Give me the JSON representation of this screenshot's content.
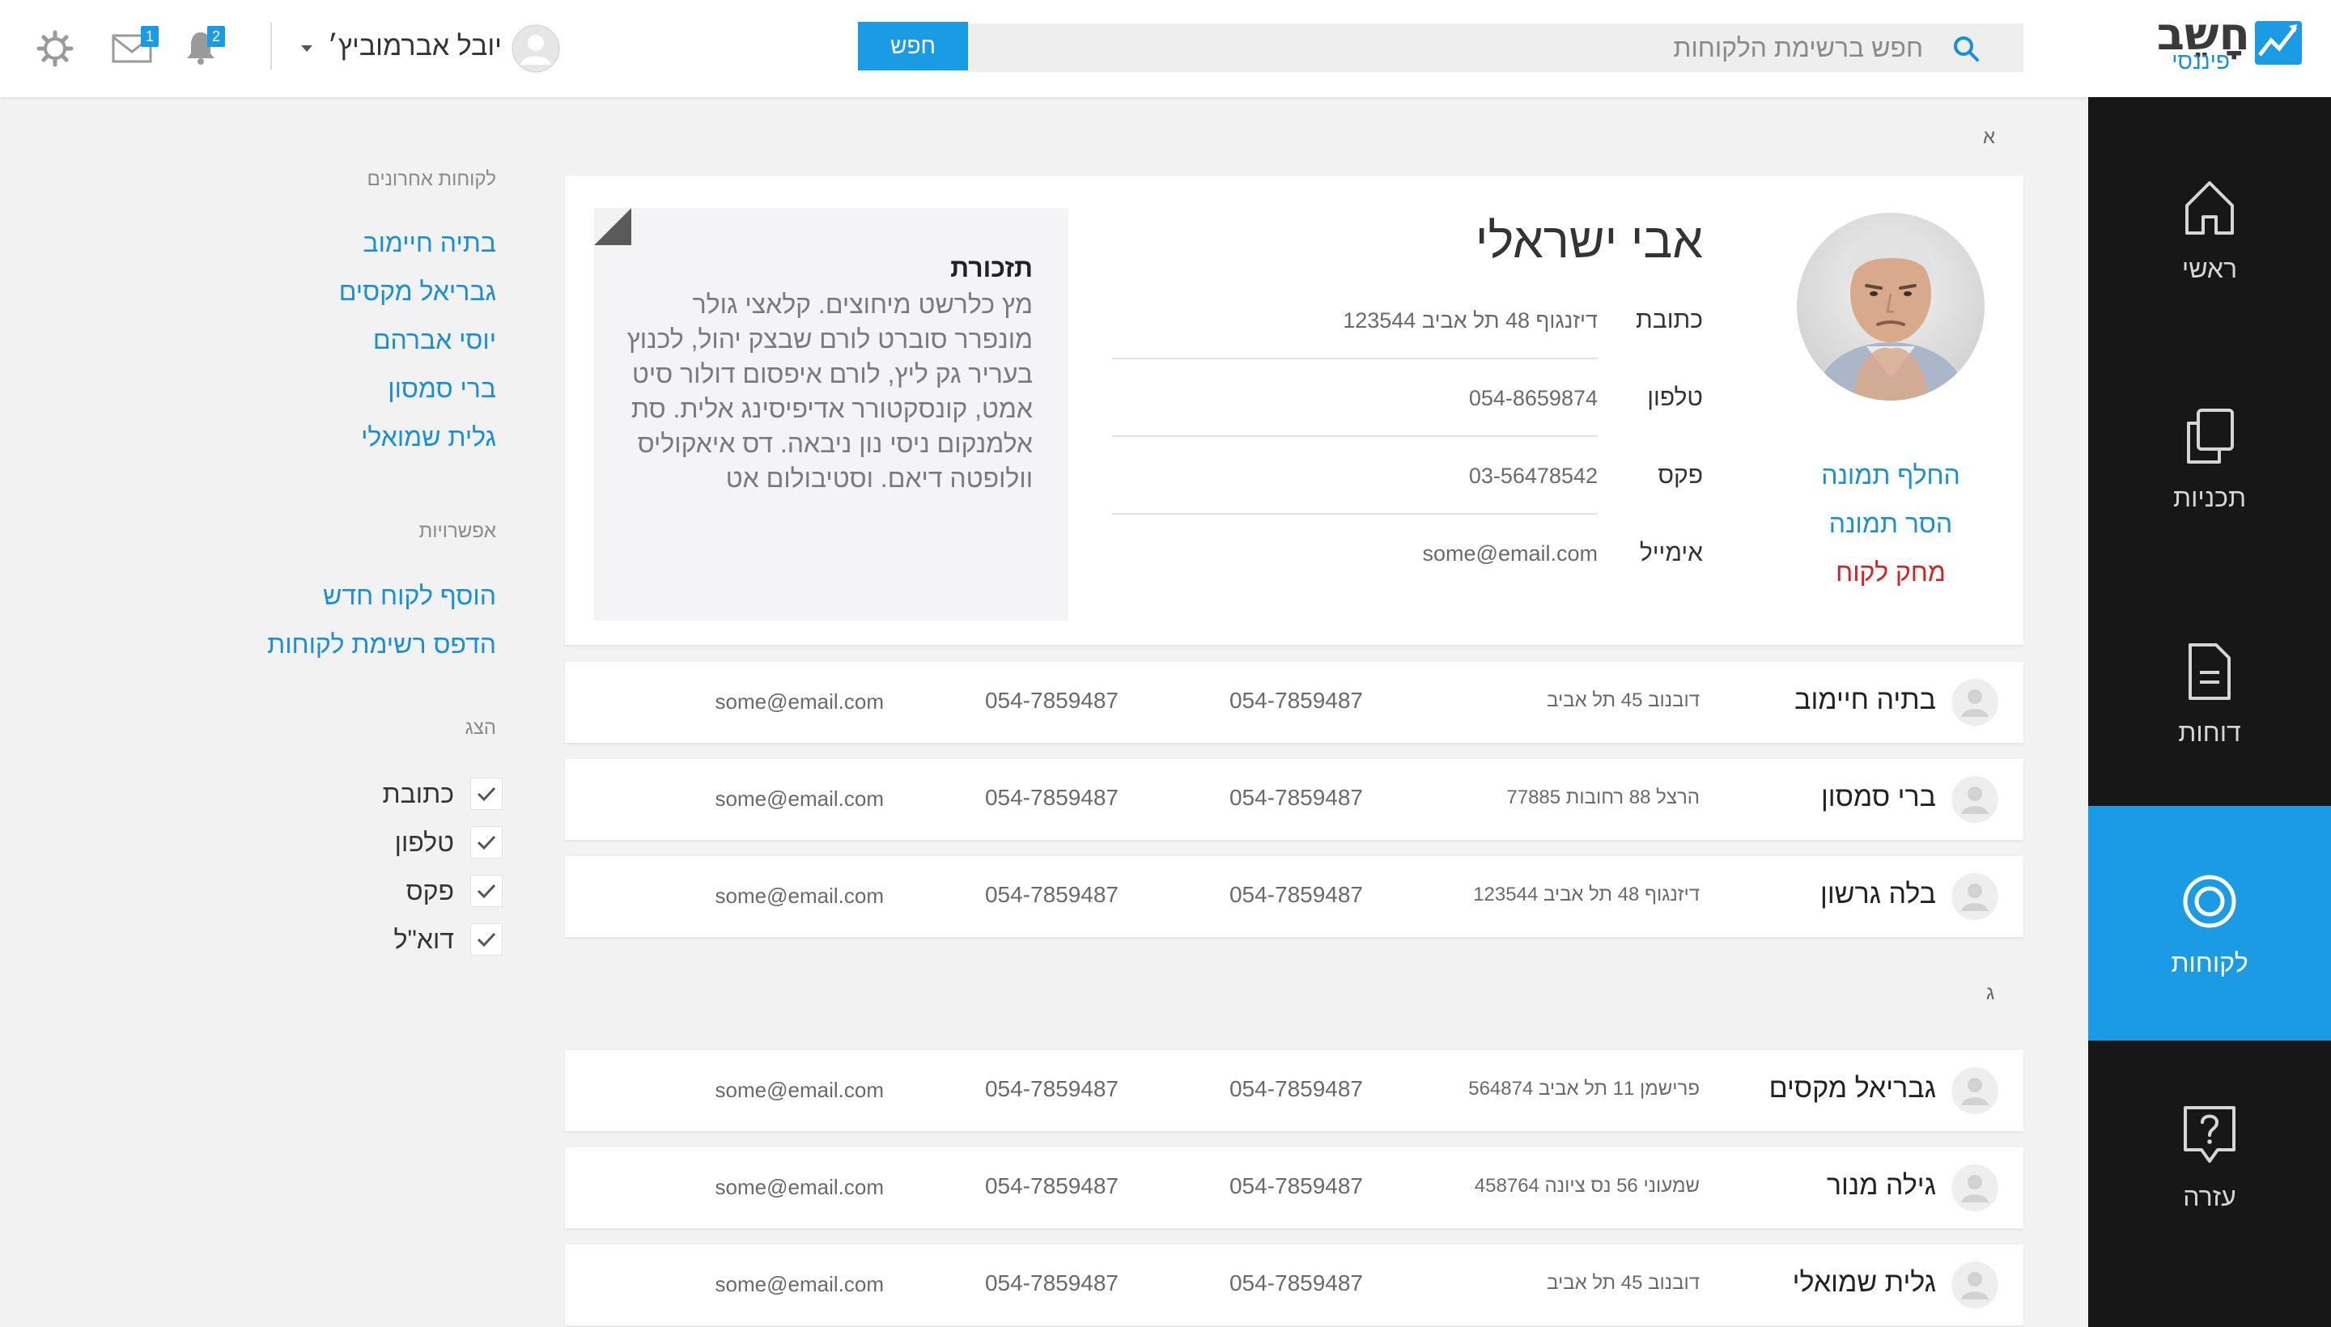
{
  "app": {
    "brand": "חָשֵב",
    "brand_sub": "פיננסי",
    "accent_color": "#1a9be3"
  },
  "header": {
    "search_placeholder": "חפש ברשימת הלקוחות",
    "search_button": "חפש",
    "user_name": "יובל אברמוביץ׳",
    "mail_badge": "1",
    "notifications_badge": "2",
    "icons": [
      "search-icon",
      "user-avatar-icon",
      "caret-down-icon",
      "envelope-icon",
      "bell-icon",
      "gear-icon"
    ]
  },
  "nav": {
    "items": [
      {
        "label": "ראשי",
        "icon": "home-icon",
        "active": false
      },
      {
        "label": "תכניות",
        "icon": "copy-icon",
        "active": false
      },
      {
        "label": "דוחות",
        "icon": "document-icon",
        "active": false
      },
      {
        "label": "לקוחות",
        "icon": "target-icon",
        "active": true
      },
      {
        "label": "עזרה",
        "icon": "help-bubble-icon",
        "active": false
      }
    ]
  },
  "panel": {
    "recent_heading": "לקוחות אחרונים",
    "recent": [
      "בתיה חיימוב",
      "גבריאל מקסים",
      "יוסי אברהם",
      "ברי סמסון",
      "גלית שמואלי"
    ],
    "options_heading": "אפשרויות",
    "options": [
      "הוסף לקוח חדש",
      "הדפס רשימת לקוחות"
    ],
    "show_heading": "הצג",
    "show": [
      {
        "label": "כתובת",
        "checked": true
      },
      {
        "label": "טלפון",
        "checked": true
      },
      {
        "label": "פקס",
        "checked": true
      },
      {
        "label": "דוא\"ל",
        "checked": true
      }
    ]
  },
  "sections": [
    {
      "letter": "א"
    },
    {
      "letter": "ג"
    }
  ],
  "detail": {
    "name": "אבי ישראלי",
    "fields": [
      {
        "label": "כתובת",
        "value": "דיזנגוף 48 תל אביב 123544"
      },
      {
        "label": "טלפון",
        "value": "054-8659874"
      },
      {
        "label": "פקס",
        "value": "03-56478542"
      },
      {
        "label": "אימייל",
        "value": "some@email.com"
      }
    ],
    "photo_actions": {
      "change": "החלף תמונה",
      "remove": "הסר תמונה",
      "delete": "מחק לקוח"
    },
    "note": {
      "title": "תזכורת",
      "body": "מץ כלרשט מיחוצים. קלאצי גולר מונפרר סוברט לורם שבצק יהול, לכנוץ בעריר גק ליץ, לורם איפסום דולור סיט אמט, קונסקטורר אדיפיסינג אלית. סת אלמנקום ניסי נון ניבאה. דס איאקוליס וולופטה דיאם. וסטיבולום אט"
    }
  },
  "section_a_rows": [
    {
      "name": "בתיה חיימוב",
      "address": "דובנוב 45 תל אביב",
      "phone": "054-7859487",
      "fax": "054-7859487",
      "email": "some@email.com"
    },
    {
      "name": "ברי סמסון",
      "address": "הרצל 88 רחובות 77885",
      "phone": "054-7859487",
      "fax": "054-7859487",
      "email": "some@email.com"
    },
    {
      "name": "בלה גרשון",
      "address": "דיזנגוף 48 תל אביב 123544",
      "phone": "054-7859487",
      "fax": "054-7859487",
      "email": "some@email.com"
    }
  ],
  "section_g_rows": [
    {
      "name": "גבריאל מקסים",
      "address": "פרישמן 11 תל אביב 564874",
      "phone": "054-7859487",
      "fax": "054-7859487",
      "email": "some@email.com"
    },
    {
      "name": "גילה מנור",
      "address": "שמעוני 56 נס ציונה 458764",
      "phone": "054-7859487",
      "fax": "054-7859487",
      "email": "some@email.com"
    },
    {
      "name": "גלית שמואלי",
      "address": "דובנוב 45 תל אביב",
      "phone": "054-7859487",
      "fax": "054-7859487",
      "email": "some@email.com"
    }
  ]
}
